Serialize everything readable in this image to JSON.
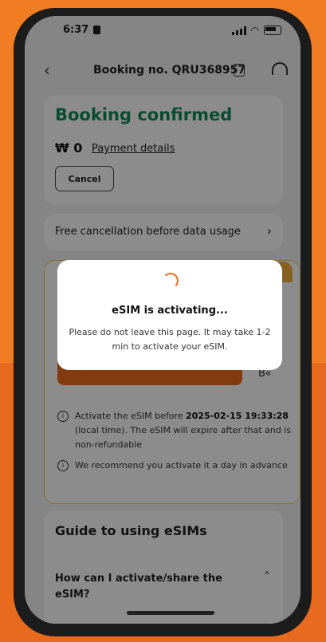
{
  "status_bar": {
    "time": "6:37"
  },
  "header": {
    "title": "Booking no. QRU368957"
  },
  "booking": {
    "status_title": "Booking confirmed",
    "amount": "₩ 0",
    "payment_link": "Payment details",
    "cancel_label": "Cancel"
  },
  "cancellation": {
    "text": "Free cancellation before data usage"
  },
  "esim_card": {
    "note1_pre": "Activate the eSIM before ",
    "note1_bold": "2025-02-15 19:33:28",
    "note1_post": " (local time). The eSIM will expire after that and is non-refundable",
    "note2": "We recommend you activate it a day in advance"
  },
  "guide": {
    "title": "Guide to using eSIMs",
    "faq_question": "How can I activate/share the eSIM?"
  },
  "modal": {
    "title": "eSIM is activating...",
    "body": "Please do not leave this page. It may take 1-2 min to activate your eSIM."
  },
  "colors": {
    "accent_orange": "#f06a1c",
    "confirm_green": "#138a5e",
    "background_orange": "#f07d24"
  }
}
